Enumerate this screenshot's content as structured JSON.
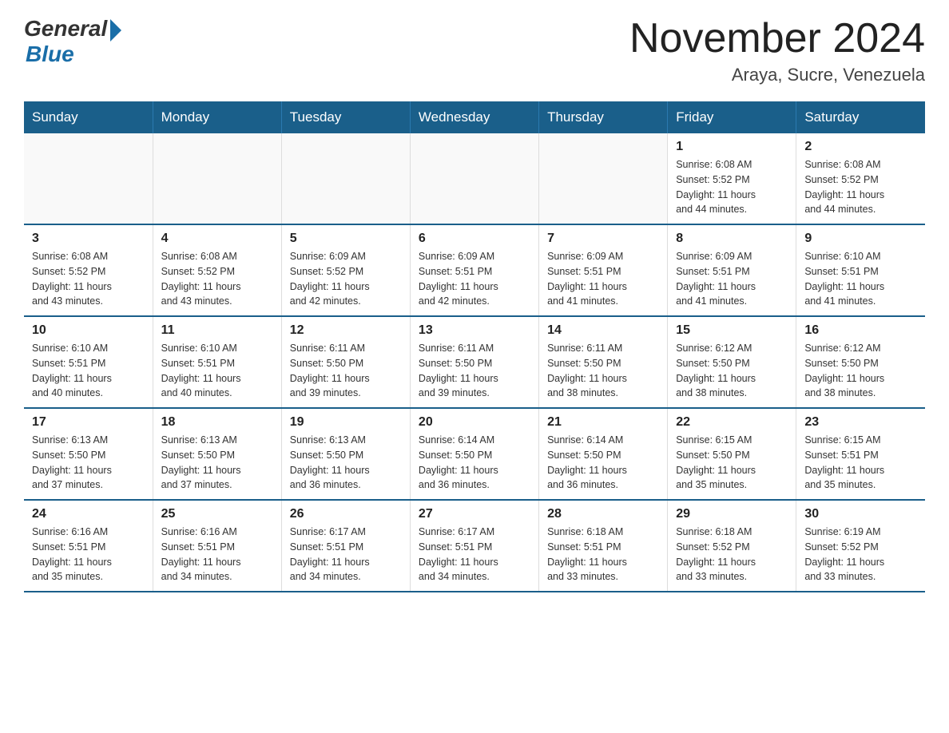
{
  "logo": {
    "general": "General",
    "blue": "Blue"
  },
  "title": {
    "month_year": "November 2024",
    "location": "Araya, Sucre, Venezuela"
  },
  "weekdays": [
    "Sunday",
    "Monday",
    "Tuesday",
    "Wednesday",
    "Thursday",
    "Friday",
    "Saturday"
  ],
  "weeks": [
    [
      {
        "day": "",
        "info": ""
      },
      {
        "day": "",
        "info": ""
      },
      {
        "day": "",
        "info": ""
      },
      {
        "day": "",
        "info": ""
      },
      {
        "day": "",
        "info": ""
      },
      {
        "day": "1",
        "info": "Sunrise: 6:08 AM\nSunset: 5:52 PM\nDaylight: 11 hours\nand 44 minutes."
      },
      {
        "day": "2",
        "info": "Sunrise: 6:08 AM\nSunset: 5:52 PM\nDaylight: 11 hours\nand 44 minutes."
      }
    ],
    [
      {
        "day": "3",
        "info": "Sunrise: 6:08 AM\nSunset: 5:52 PM\nDaylight: 11 hours\nand 43 minutes."
      },
      {
        "day": "4",
        "info": "Sunrise: 6:08 AM\nSunset: 5:52 PM\nDaylight: 11 hours\nand 43 minutes."
      },
      {
        "day": "5",
        "info": "Sunrise: 6:09 AM\nSunset: 5:52 PM\nDaylight: 11 hours\nand 42 minutes."
      },
      {
        "day": "6",
        "info": "Sunrise: 6:09 AM\nSunset: 5:51 PM\nDaylight: 11 hours\nand 42 minutes."
      },
      {
        "day": "7",
        "info": "Sunrise: 6:09 AM\nSunset: 5:51 PM\nDaylight: 11 hours\nand 41 minutes."
      },
      {
        "day": "8",
        "info": "Sunrise: 6:09 AM\nSunset: 5:51 PM\nDaylight: 11 hours\nand 41 minutes."
      },
      {
        "day": "9",
        "info": "Sunrise: 6:10 AM\nSunset: 5:51 PM\nDaylight: 11 hours\nand 41 minutes."
      }
    ],
    [
      {
        "day": "10",
        "info": "Sunrise: 6:10 AM\nSunset: 5:51 PM\nDaylight: 11 hours\nand 40 minutes."
      },
      {
        "day": "11",
        "info": "Sunrise: 6:10 AM\nSunset: 5:51 PM\nDaylight: 11 hours\nand 40 minutes."
      },
      {
        "day": "12",
        "info": "Sunrise: 6:11 AM\nSunset: 5:50 PM\nDaylight: 11 hours\nand 39 minutes."
      },
      {
        "day": "13",
        "info": "Sunrise: 6:11 AM\nSunset: 5:50 PM\nDaylight: 11 hours\nand 39 minutes."
      },
      {
        "day": "14",
        "info": "Sunrise: 6:11 AM\nSunset: 5:50 PM\nDaylight: 11 hours\nand 38 minutes."
      },
      {
        "day": "15",
        "info": "Sunrise: 6:12 AM\nSunset: 5:50 PM\nDaylight: 11 hours\nand 38 minutes."
      },
      {
        "day": "16",
        "info": "Sunrise: 6:12 AM\nSunset: 5:50 PM\nDaylight: 11 hours\nand 38 minutes."
      }
    ],
    [
      {
        "day": "17",
        "info": "Sunrise: 6:13 AM\nSunset: 5:50 PM\nDaylight: 11 hours\nand 37 minutes."
      },
      {
        "day": "18",
        "info": "Sunrise: 6:13 AM\nSunset: 5:50 PM\nDaylight: 11 hours\nand 37 minutes."
      },
      {
        "day": "19",
        "info": "Sunrise: 6:13 AM\nSunset: 5:50 PM\nDaylight: 11 hours\nand 36 minutes."
      },
      {
        "day": "20",
        "info": "Sunrise: 6:14 AM\nSunset: 5:50 PM\nDaylight: 11 hours\nand 36 minutes."
      },
      {
        "day": "21",
        "info": "Sunrise: 6:14 AM\nSunset: 5:50 PM\nDaylight: 11 hours\nand 36 minutes."
      },
      {
        "day": "22",
        "info": "Sunrise: 6:15 AM\nSunset: 5:50 PM\nDaylight: 11 hours\nand 35 minutes."
      },
      {
        "day": "23",
        "info": "Sunrise: 6:15 AM\nSunset: 5:51 PM\nDaylight: 11 hours\nand 35 minutes."
      }
    ],
    [
      {
        "day": "24",
        "info": "Sunrise: 6:16 AM\nSunset: 5:51 PM\nDaylight: 11 hours\nand 35 minutes."
      },
      {
        "day": "25",
        "info": "Sunrise: 6:16 AM\nSunset: 5:51 PM\nDaylight: 11 hours\nand 34 minutes."
      },
      {
        "day": "26",
        "info": "Sunrise: 6:17 AM\nSunset: 5:51 PM\nDaylight: 11 hours\nand 34 minutes."
      },
      {
        "day": "27",
        "info": "Sunrise: 6:17 AM\nSunset: 5:51 PM\nDaylight: 11 hours\nand 34 minutes."
      },
      {
        "day": "28",
        "info": "Sunrise: 6:18 AM\nSunset: 5:51 PM\nDaylight: 11 hours\nand 33 minutes."
      },
      {
        "day": "29",
        "info": "Sunrise: 6:18 AM\nSunset: 5:52 PM\nDaylight: 11 hours\nand 33 minutes."
      },
      {
        "day": "30",
        "info": "Sunrise: 6:19 AM\nSunset: 5:52 PM\nDaylight: 11 hours\nand 33 minutes."
      }
    ]
  ]
}
